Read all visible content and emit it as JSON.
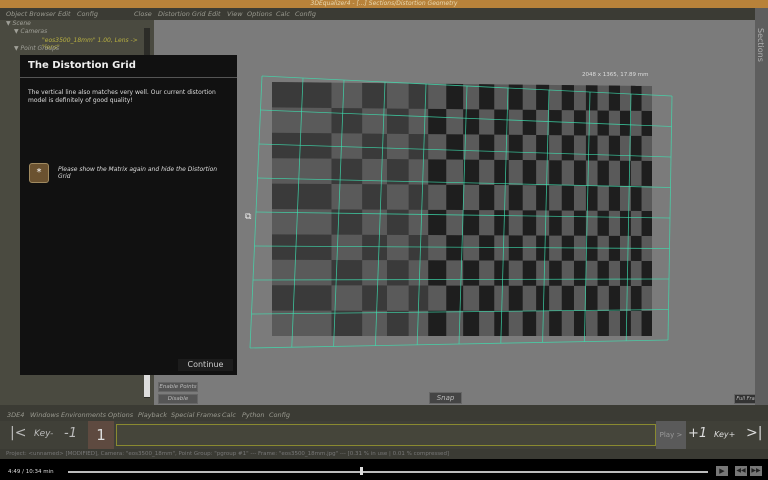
{
  "window": {
    "title": "3DEqualizer4 - [...] Sections/Distortion Geometry"
  },
  "menubar": {
    "left": [
      "Object Browser",
      "Edit",
      "Config"
    ],
    "close": "Close",
    "right": [
      "Distortion Grid",
      "Edit",
      "View",
      "Options",
      "Calc",
      "Config"
    ]
  },
  "tree": {
    "scene": "Scene",
    "cameras": "Cameras",
    "camera_item": "\"eos3500_18mm\" 1.00, Lens -> \"lens\"",
    "point_groups": "Point Groups"
  },
  "viewport": {
    "image_info": "2048 x 1365, 17.89 mm",
    "snap": "Snap",
    "full_frame": "Full Frame"
  },
  "sections_label": "Sections",
  "dialog": {
    "title": "The Distortion Grid",
    "text": "The vertical line also matches very well. Our current distortion model is definitely of good quality!",
    "task_icon": "*",
    "task": "Please show the Matrix again and hide the Distortion Grid",
    "continue": "Continue"
  },
  "point_buttons": {
    "enable": "Enable Points",
    "disable": "Disable Points"
  },
  "bottom_menu": [
    "3DE4",
    "Windows",
    "Environments",
    "Options",
    "Playback",
    "Special Frames",
    "Calc",
    "Python",
    "Config"
  ],
  "timeline": {
    "first": "|<",
    "key_prev": "Key-",
    "minus": "-1",
    "frame": "1",
    "play": "Play >",
    "plus": "+1",
    "key_next": "Key+",
    "last": ">|"
  },
  "status": "Project: <unnamed> [MODIFIED], Camera: \"eos3500_18mm\", Point Group: \"pgroup #1\" --- Frame: \"eos3500_18mm.jpg\" --- [0.31 % in use | 0.01 % compressed]",
  "video": {
    "time": "4:49 / 10:34 min",
    "progress": 0.456
  },
  "colors": {
    "grid": "#3ee0b0",
    "accent": "#b8823a"
  }
}
